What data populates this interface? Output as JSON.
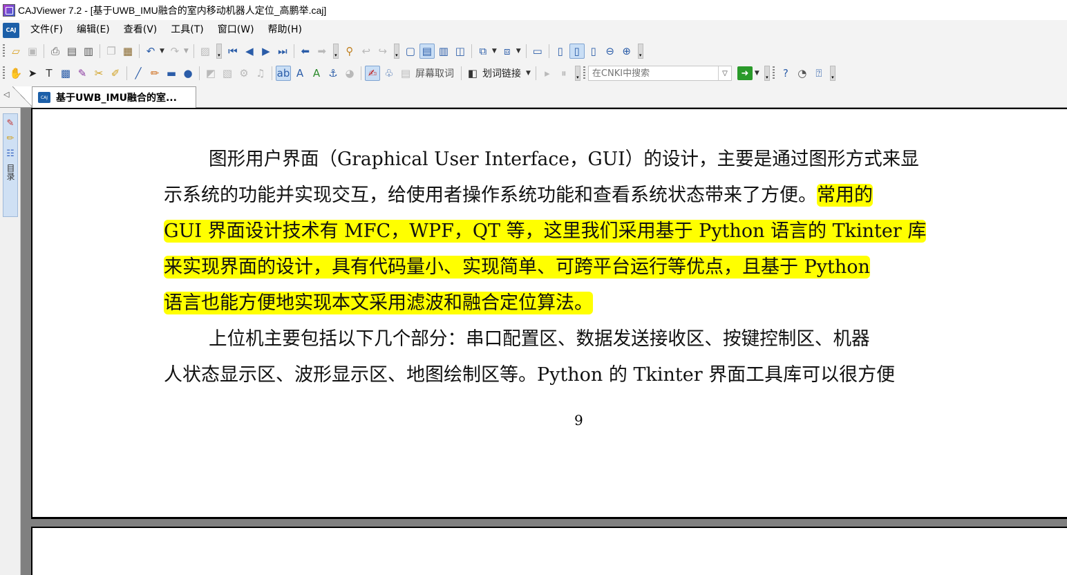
{
  "window": {
    "title": "CAJViewer 7.2 - [基于UWB_IMU融合的室内移动机器人定位_高鹏举.caj]"
  },
  "menu": {
    "items": [
      "文件(F)",
      "编辑(E)",
      "查看(V)",
      "工具(T)",
      "窗口(W)",
      "帮助(H)"
    ]
  },
  "toolbar2": {
    "screen_capture_label": "屏幕取词",
    "link_label": "划词链接",
    "search_placeholder": "在CNKI中搜索"
  },
  "tabs": [
    {
      "label": "基于UWB_IMU融合的室..."
    }
  ],
  "sidepanel": {
    "toc_label": "目录"
  },
  "document": {
    "lines": [
      {
        "plain": "图形用户界面（Graphical User Interface，GUI）的设计，主要是通过图形方式来显",
        "highlight": ""
      },
      {
        "plain": "示系统的功能并实现交互，给使用者操作系统功能和查看系统状态带来了方便。",
        "highlight": "常用的"
      },
      {
        "plain": "",
        "highlight": "GUI 界面设计技术有 MFC，WPF，QT 等，这里我们采用基于 Python 语言的 Tkinter 库"
      },
      {
        "plain": "",
        "highlight": "来实现界面的设计，具有代码量小、实现简单、可跨平台运行等优点，且基于 Python"
      },
      {
        "plain": "",
        "highlight": "语言也能方便地实现本文采用滤波和融合定位算法。"
      },
      {
        "plain": "上位机主要包括以下几个部分：串口配置区、数据发送接收区、按键控制区、机器",
        "highlight": ""
      },
      {
        "plain": "人状态显示区、波形显示区、地图绘制区等。Python 的 Tkinter 界面工具库可以很方便",
        "highlight": ""
      }
    ],
    "page_number": "9"
  }
}
